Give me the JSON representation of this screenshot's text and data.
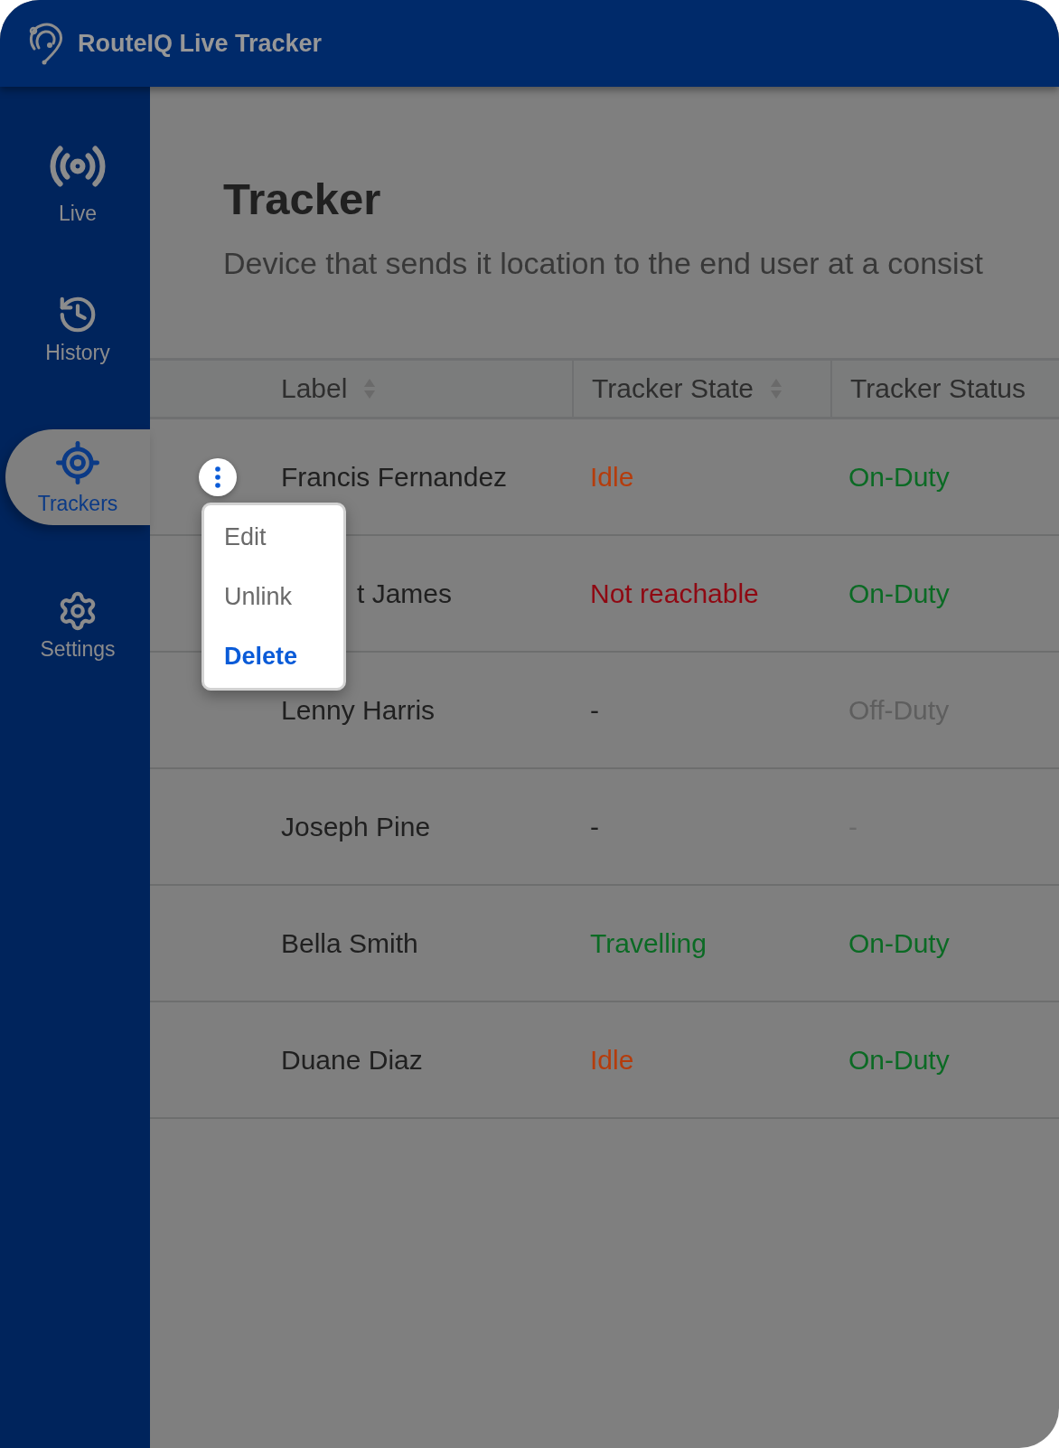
{
  "app": {
    "title": "RouteIQ Live Tracker"
  },
  "sidebar": {
    "items": [
      {
        "label": "Live",
        "kind": "live",
        "selected": false
      },
      {
        "label": "History",
        "kind": "history",
        "selected": false
      },
      {
        "label": "Trackers",
        "kind": "trackers",
        "selected": true
      },
      {
        "label": "Settings",
        "kind": "settings",
        "selected": false
      }
    ]
  },
  "page": {
    "title": "Tracker",
    "description": "Device that sends it location to the end user at a consist"
  },
  "table": {
    "columns": [
      {
        "label": "Label",
        "sortable": true
      },
      {
        "label": "Tracker State",
        "sortable": true
      },
      {
        "label": "Tracker Status",
        "sortable": false
      }
    ],
    "rows": [
      {
        "label": "Francis Fernandez",
        "actions_open": true,
        "partly_hidden": false,
        "state": {
          "text": "Idle",
          "color": "#b53c0c"
        },
        "status": {
          "text": "On-Duty",
          "color": "#0b6a24"
        }
      },
      {
        "label": "t James",
        "actions_open": false,
        "partly_hidden": true,
        "state": {
          "text": "Not reachable",
          "color": "#8f0812"
        },
        "status": {
          "text": "On-Duty",
          "color": "#0b6a24"
        }
      },
      {
        "label": "Lenny Harris",
        "actions_open": false,
        "partly_hidden": false,
        "state": {
          "text": "-",
          "color": "#1e1e1e"
        },
        "status": {
          "text": "Off-Duty",
          "color": "#5e5e5e"
        }
      },
      {
        "label": "Joseph Pine",
        "actions_open": false,
        "partly_hidden": false,
        "state": {
          "text": "-",
          "color": "#1e1e1e"
        },
        "status": {
          "text": "-",
          "color": "#6a6a6a"
        }
      },
      {
        "label": "Bella Smith",
        "actions_open": false,
        "partly_hidden": false,
        "state": {
          "text": "Travelling",
          "color": "#0b6a24"
        },
        "status": {
          "text": "On-Duty",
          "color": "#0b6a24"
        }
      },
      {
        "label": "Duane Diaz",
        "actions_open": false,
        "partly_hidden": false,
        "state": {
          "text": "Idle",
          "color": "#b53c0c"
        },
        "status": {
          "text": "On-Duty",
          "color": "#0b6a24"
        }
      }
    ]
  },
  "row_menu": {
    "items": [
      {
        "label": "Edit",
        "kind": "normal"
      },
      {
        "label": "Unlink",
        "kind": "normal"
      },
      {
        "label": "Delete",
        "kind": "danger"
      }
    ]
  }
}
